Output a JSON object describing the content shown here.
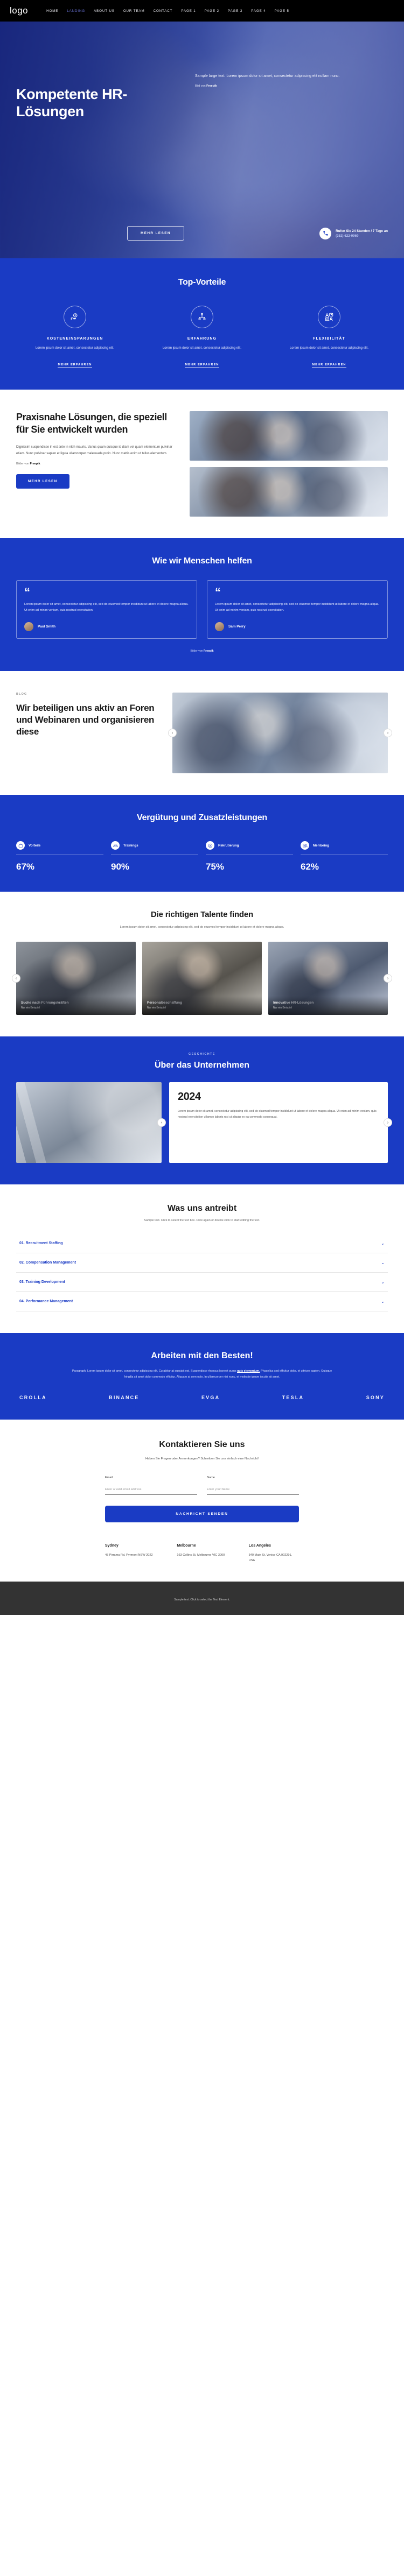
{
  "nav": {
    "logo": "logo",
    "links": [
      {
        "label": "HOME",
        "active": false
      },
      {
        "label": "LANDING",
        "active": true
      },
      {
        "label": "ABOUT US",
        "active": false
      },
      {
        "label": "OUR TEAM",
        "active": false
      },
      {
        "label": "CONTACT",
        "active": false
      },
      {
        "label": "PAGE 1",
        "active": false
      },
      {
        "label": "PAGE 2",
        "active": false
      },
      {
        "label": "PAGE 3",
        "active": false
      },
      {
        "label": "PAGE 4",
        "active": false
      },
      {
        "label": "PAGE 5",
        "active": false
      }
    ]
  },
  "hero": {
    "heading": "Kompetente HR-Lösungen",
    "paragraph": "Sample large text. Lorem ipsum dolor sit amet, consectetur adipiscing elit nullam nunc.",
    "credit_prefix": "Bild von ",
    "credit_name": "Freepik",
    "cta": "MEHR LESEN",
    "phone_label": "Rufen Sie 24 Stunden / 7 Tage an",
    "phone_number": "(352) 622-9969"
  },
  "benefits": {
    "title": "Top-Vorteile",
    "items": [
      {
        "icon": "money-hand-icon",
        "title": "KOSTENEINSPARUNGEN",
        "text": "Lorem ipsum dolor sit amet, consectetur adipiscing elit.",
        "link": "MEHR ERFAHREN"
      },
      {
        "icon": "org-chart-icon",
        "title": "ERFAHRUNG",
        "text": "Lorem ipsum dolor sit amet, consectetur adipiscing elit.",
        "link": "MEHR ERFAHREN"
      },
      {
        "icon": "people-question-icon",
        "title": "FLEXIBILITÄT",
        "text": "Lorem ipsum dolor sit amet, consectetur adipiscing elit.",
        "link": "MEHR ERFAHREN"
      }
    ]
  },
  "practical": {
    "heading": "Praxisnahe Lösungen, die speziell für Sie entwickelt wurden",
    "paragraph": "Dignissim suspendisse in est ante in nibh mauris. Varius quam quisque id diam vel quam elementum pulvinar etiam. Nunc pulvinar sapien et ligula ullamcorper malesuada proin. Nunc mattis enim ut tellus elementum.",
    "credit_prefix": "Bilder von ",
    "credit_name": "Freepik",
    "cta": "MEHR LESEN"
  },
  "testimonials": {
    "title": "Wie wir Menschen helfen",
    "items": [
      {
        "quote": "Lorem ipsum dolor sit amet, consectetur adipiscing elit, sed do eiusmod tempor incididunt ut labore et dolore magna aliqua. Ut enim ad minim veniam, quis nostrud exercitation.",
        "name": "Paul Smith"
      },
      {
        "quote": "Lorem ipsum dolor sit amet, consectetur adipiscing elit, sed do eiusmod tempor incididunt ut labore et dolore magna aliqua. Ut enim ad minim veniam, quis nostrud exercitation.",
        "name": "Sam Perry"
      }
    ],
    "credit_prefix": "Bilder von ",
    "credit_name": "Freepik"
  },
  "webinar": {
    "kicker": "BLOG",
    "heading": "Wir beteiligen uns aktiv an Foren und Webinaren und organisieren diese",
    "prev": "‹",
    "next": "›"
  },
  "stats": {
    "title": "Vergütung und Zusatzleistungen",
    "items": [
      {
        "icon": "briefcase-icon",
        "label": "Vorteile",
        "value": "67%"
      },
      {
        "icon": "group-icon",
        "label": "Trainings",
        "value": "90%"
      },
      {
        "icon": "target-icon",
        "label": "Rekrutierung",
        "value": "75%"
      },
      {
        "icon": "id-card-icon",
        "label": "Mentoring",
        "value": "62%"
      }
    ]
  },
  "talent": {
    "title": "Die richtigen Talente finden",
    "subtitle": "Lorem ipsum dolor sit amet, consectetur adipiscing elit, sed do eiusmod tempor incididunt ut labore et dolore magna aliqua.",
    "cards": [
      {
        "title": "Suche nach Führungskräften",
        "subtitle": "Nur ein Beispiel"
      },
      {
        "title": "Personalbeschaffung",
        "subtitle": "Nur ein Beispiel"
      },
      {
        "title": "Innovative HR-Lösungen",
        "subtitle": "Nur ein Beispiel"
      }
    ],
    "prev": "‹",
    "next": "›"
  },
  "about": {
    "kicker": "GESCHICHTE",
    "title": "Über das Unternehmen",
    "year": "2024",
    "paragraph": "Lorem ipsum dolor sit amet, consectetur adipiscing elit, sed do eiusmod tempor incididunt ut labore et dolore magna aliqua. Ut enim ad minim veniam, quis nostrud exercitation ullamco laboris nisi ut aliquip ex ea commodo consequat.",
    "prev": "‹",
    "next": "›"
  },
  "accordion": {
    "title": "Was uns antreibt",
    "subtitle": "Sample text. Click to select the text box. Click again or double click to start editing the text.",
    "items": [
      {
        "label": "01. Recruitment Staffing",
        "chevron": "⌄"
      },
      {
        "label": "02. Compensation Management",
        "chevron": "⌄"
      },
      {
        "label": "03. Training Development",
        "chevron": "⌄"
      },
      {
        "label": "04. Performance Management",
        "chevron": "⌄"
      }
    ]
  },
  "partners": {
    "title": "Arbeiten mit den Besten!",
    "subtitle_a": "Paragraph. Lorem ipsum dolor sit amet, consectetur adipiscing elit. Curabitur at suscipit est. Suspendisse rhoncus laoreet purus ",
    "subtitle_link": "quis elementum.",
    "subtitle_b": " Phasellus sed efficitur dolor, et ultrices sapien. Quisque fringilla sit amet dolor commodo efficitur. Aliquam at sem odio. In ullamcorper nisi nunc, et molestie ipsum iaculis sit amet.",
    "logos": [
      "CROLLA",
      "BINANCE",
      "EVGA",
      "TESLA",
      "SONY"
    ]
  },
  "contact": {
    "title": "Kontaktieren Sie uns",
    "subtitle": "Haben Sie Fragen oder Anmerkungen? Schreiben Sie uns einfach eine Nachricht!",
    "email_label": "Email",
    "email_placeholder": "Enter a valid email address",
    "email_value": "",
    "name_label": "Name",
    "name_placeholder": "Enter your Name",
    "name_value": "",
    "submit": "NACHRICHT SENDEN",
    "offices": [
      {
        "city": "Sydney",
        "address": "45 Pirrama Rd, Pyrmont NSW 2022"
      },
      {
        "city": "Melbourne",
        "address": "163 Collins St, Melbourne VIC 3000"
      },
      {
        "city": "Los Angeles",
        "address": "340 Main St, Venice CA 902291, USA"
      }
    ]
  },
  "footer": {
    "text": "Sample text. Click to select the Text Element."
  },
  "colors": {
    "brand_blue": "#1a3bc4",
    "nav_black": "#000000",
    "footer_gray": "#333333"
  }
}
